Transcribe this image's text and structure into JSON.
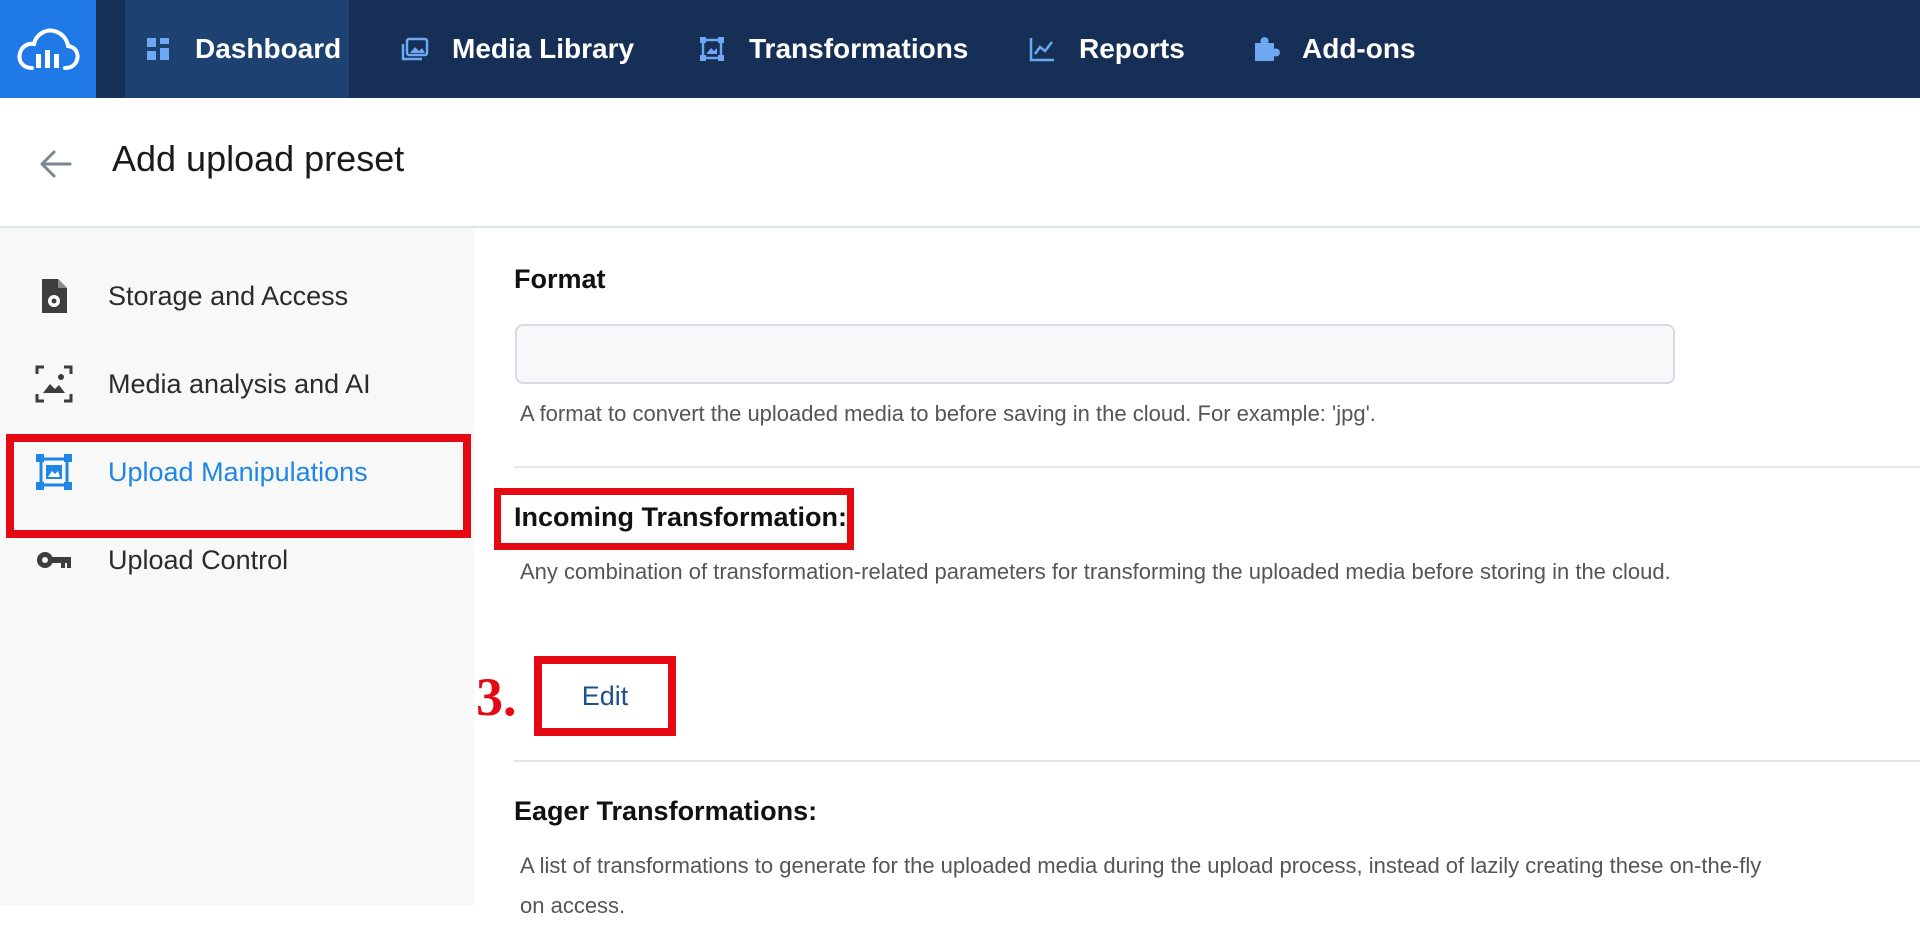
{
  "nav": {
    "items": [
      {
        "label": "Dashboard",
        "icon": "dashboard-icon"
      },
      {
        "label": "Media Library",
        "icon": "media-library-icon"
      },
      {
        "label": "Transformations",
        "icon": "transformations-icon"
      },
      {
        "label": "Reports",
        "icon": "reports-icon"
      },
      {
        "label": "Add-ons",
        "icon": "addons-icon"
      }
    ],
    "active": "Dashboard",
    "colors": {
      "bar": "#152f57",
      "logo_bg": "#1f7ae8",
      "active_bg": "#1d4272"
    }
  },
  "header": {
    "title": "Add upload preset"
  },
  "sidebar": {
    "items": [
      {
        "label": "Storage and Access",
        "icon": "file-gear-icon"
      },
      {
        "label": "Media analysis and AI",
        "icon": "image-scan-icon"
      },
      {
        "label": "Upload Manipulations",
        "icon": "frame-image-icon"
      },
      {
        "label": "Upload Control",
        "icon": "key-icon"
      }
    ],
    "active": "Upload Manipulations"
  },
  "main": {
    "format": {
      "title": "Format",
      "value": "",
      "description": "A format to convert the uploaded media to before saving in the cloud. For example: 'jpg'."
    },
    "incoming": {
      "title": "Incoming Transformation:",
      "description": "Any combination of transformation-related parameters for transforming the uploaded media before storing in the cloud.",
      "edit_label": "Edit"
    },
    "eager": {
      "title": "Eager Transformations:",
      "description": "A list of transformations to generate for the uploaded media during the upload process, instead of lazily creating these on-the-fly on access."
    }
  },
  "annotation": {
    "step_label": "3.",
    "highlight_color": "#e50914"
  }
}
